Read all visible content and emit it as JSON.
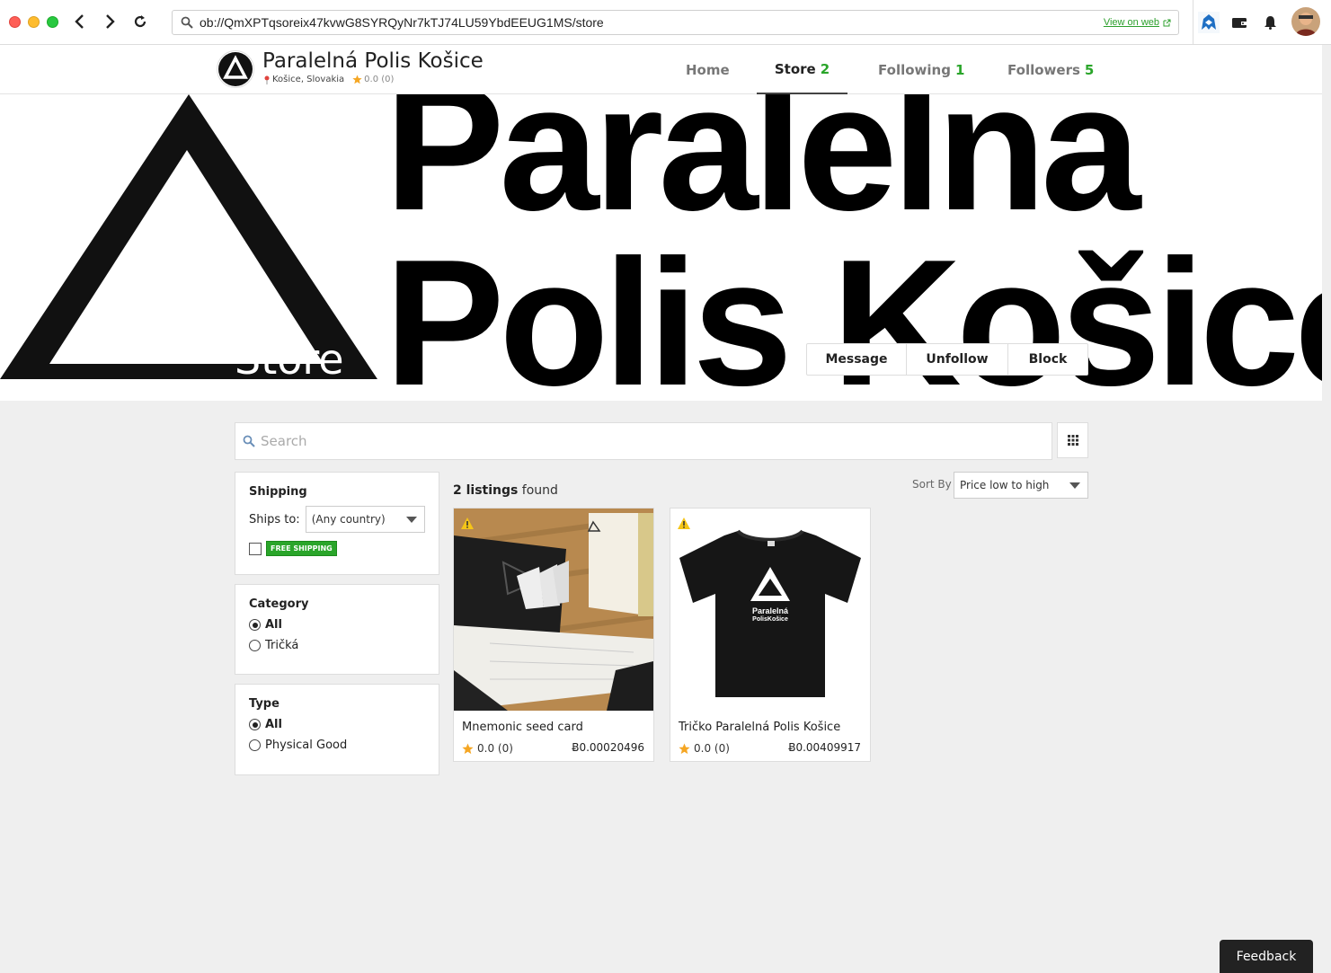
{
  "browser": {
    "url": "ob://QmXPTqsoreix47kvwG8SYRQyNr7kTJ74LU59YbdEEUG1MS/store",
    "view_on_web": "View on web"
  },
  "header": {
    "store_name": "Paralelná Polis Košice",
    "location": "Košice, Slovakia",
    "rating": "0.0 (0)",
    "tabs": [
      {
        "label": "Home",
        "count": ""
      },
      {
        "label": "Store",
        "count": "2"
      },
      {
        "label": "Following",
        "count": "1"
      },
      {
        "label": "Followers",
        "count": "5"
      }
    ]
  },
  "banner": {
    "line1": "Paralelna",
    "line2": "Polis Košice",
    "overlay_title": "Store",
    "actions": {
      "message": "Message",
      "unfollow": "Unfollow",
      "block": "Block"
    }
  },
  "search": {
    "placeholder": "Search"
  },
  "filters": {
    "shipping": {
      "heading": "Shipping",
      "ships_to_label": "Ships to:",
      "ships_to_value": "(Any country)",
      "free_shipping": "FREE SHIPPING"
    },
    "category": {
      "heading": "Category",
      "options": [
        "All",
        "Tričká"
      ],
      "selected": "All"
    },
    "type": {
      "heading": "Type",
      "options": [
        "All",
        "Physical Good"
      ],
      "selected": "All"
    }
  },
  "results": {
    "count_bold": "2 listings",
    "count_suffix": " found",
    "sort_label": "Sort By",
    "sort_value": "Price low to high"
  },
  "listings": [
    {
      "title": "Mnemonic seed card",
      "rating": "0.0 (0)",
      "price": "Ƀ0.00020496"
    },
    {
      "title": "Tričko Paralelná Polis Košice",
      "rating": "0.0 (0)",
      "price": "Ƀ0.00409917"
    }
  ],
  "feedback": "Feedback",
  "colors": {
    "accent_green": "#2aa52a",
    "star": "#f5a623",
    "warning": "#f5c518"
  }
}
